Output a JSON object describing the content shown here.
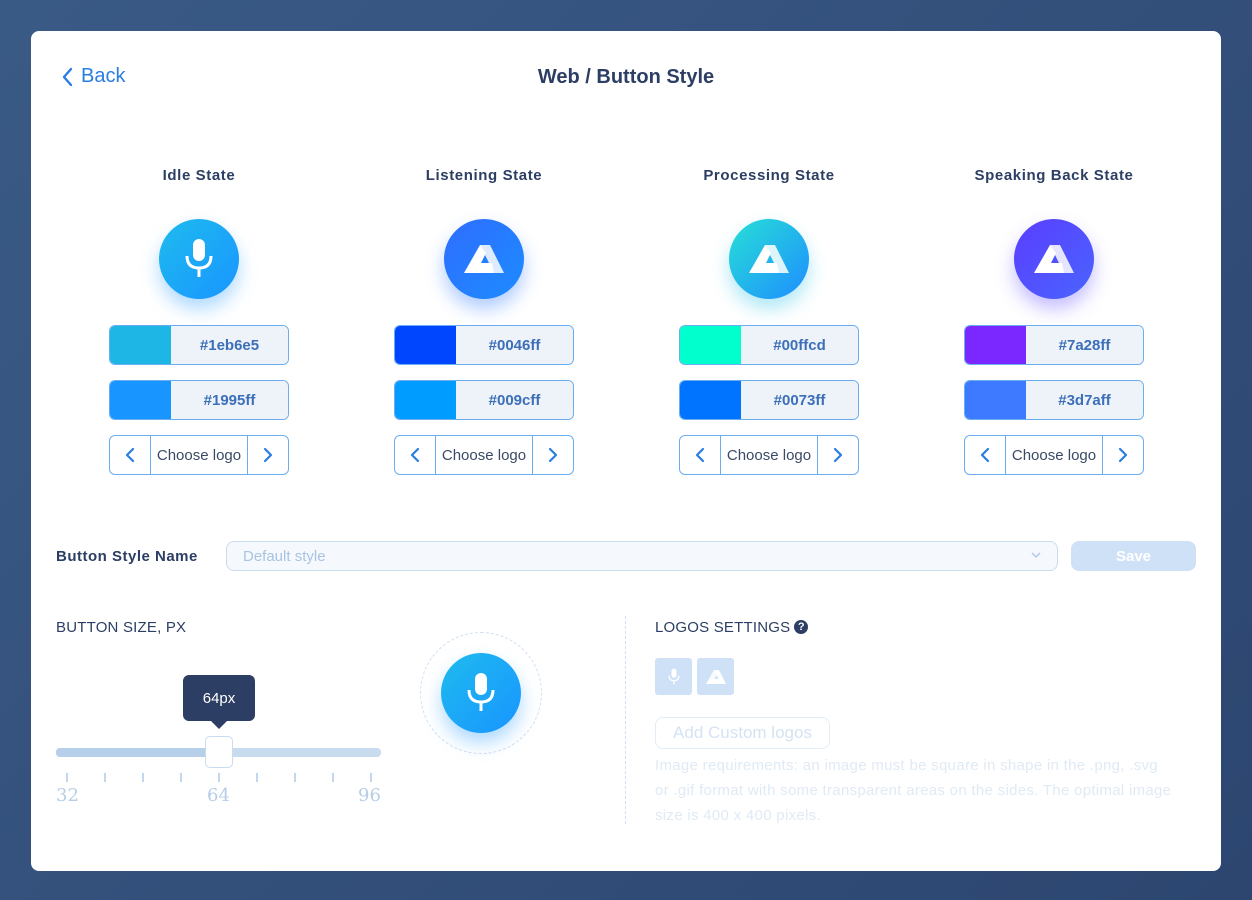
{
  "header": {
    "back_label": "Back",
    "title": "Web / Button Style"
  },
  "states": [
    {
      "title": "Idle State",
      "icon": "microphone-icon",
      "primary_color": "#1eb6e5",
      "secondary_color": "#1995ff",
      "logo_label": "Choose logo"
    },
    {
      "title": "Listening State",
      "icon": "brand-logo-icon",
      "primary_color": "#0046ff",
      "secondary_color": "#009cff",
      "logo_label": "Choose logo"
    },
    {
      "title": "Processing State",
      "icon": "brand-logo-icon",
      "primary_color": "#00ffcd",
      "secondary_color": "#0073ff",
      "logo_label": "Choose logo"
    },
    {
      "title": "Speaking Back State",
      "icon": "brand-logo-icon",
      "primary_color": "#7a28ff",
      "secondary_color": "#3d7aff",
      "logo_label": "Choose logo"
    }
  ],
  "style_name": {
    "label": "Button Style Name",
    "placeholder": "Default style",
    "save_label": "Save"
  },
  "button_size": {
    "label": "BUTTON SIZE, PX",
    "tooltip": "64px",
    "min": 32,
    "max": 96,
    "value": 64,
    "tick_labels": [
      "32",
      "64",
      "96"
    ]
  },
  "logos_settings": {
    "label": "LOGOS SETTINGS",
    "help_icon": "?",
    "thumbs": [
      "microphone-icon",
      "brand-logo-icon"
    ],
    "add_label": "Add Custom logos",
    "requirements": "Image requirements: an image must be square in shape in the .png, .svg or .gif format with some transparent areas on the sides. The optimal image size is 400 x 400 pixels."
  }
}
